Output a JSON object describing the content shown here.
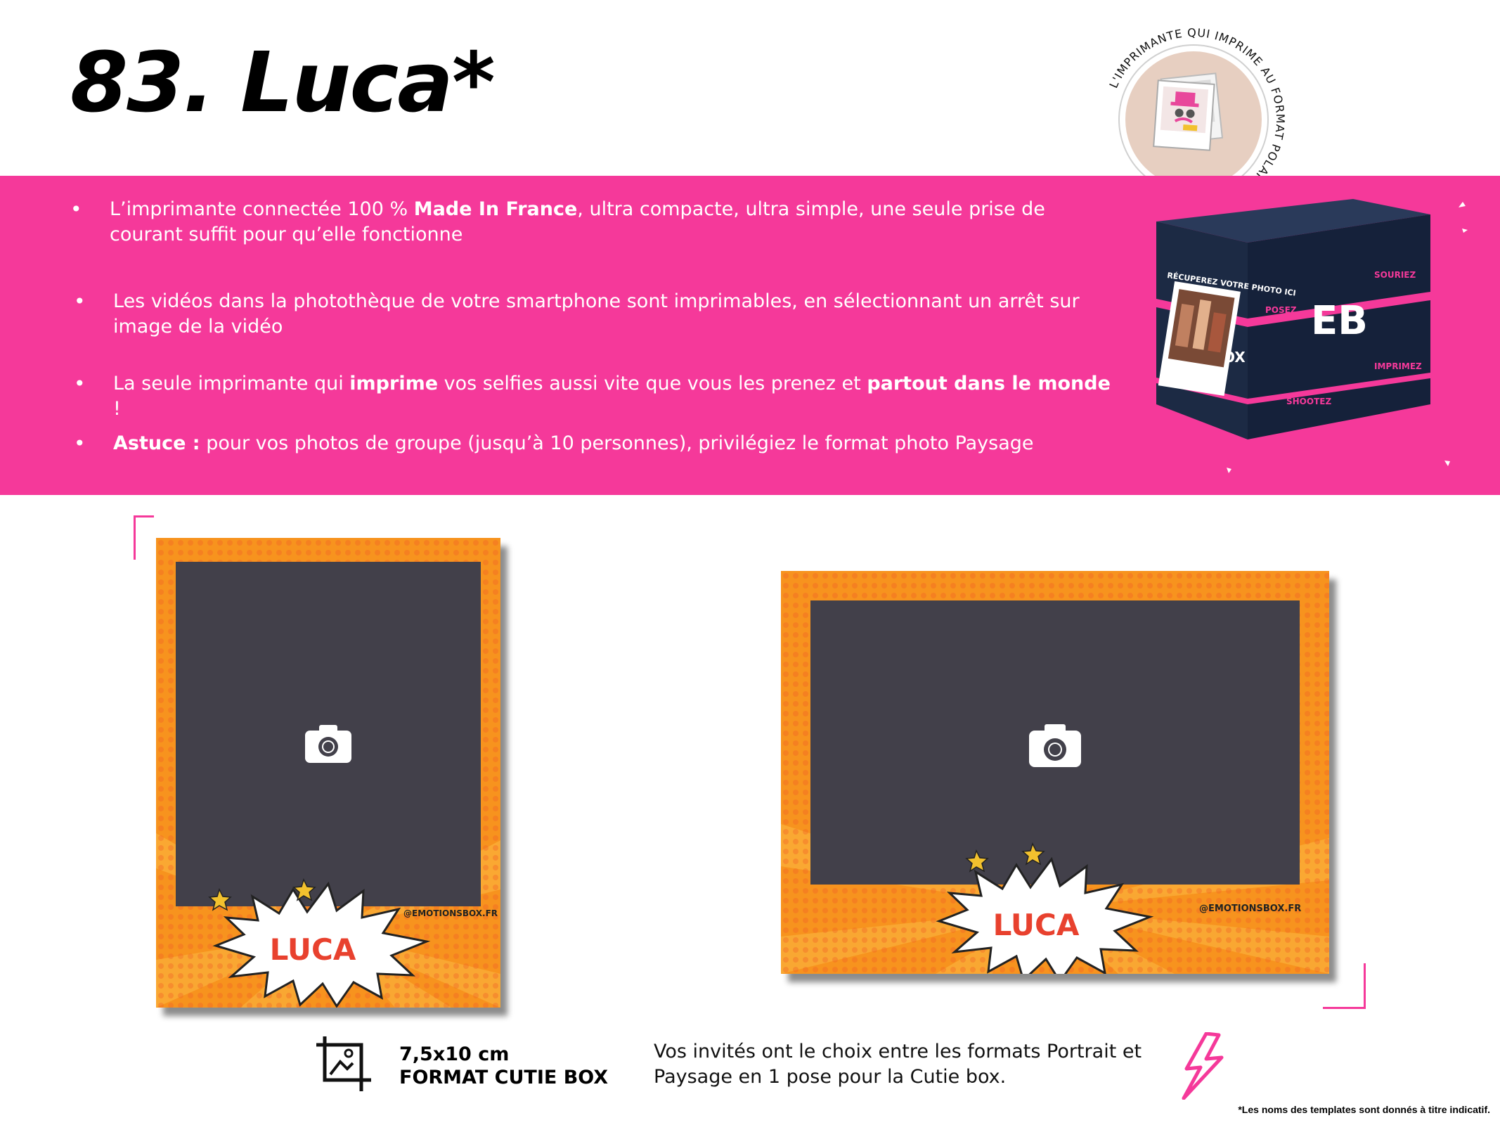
{
  "page": {
    "title": "83. Luca*"
  },
  "badge": {
    "ring_text": "L'IMPRIMANTE QUI IMPRIME AU FORMAT POLAROÏD"
  },
  "bullets": [
    {
      "parts": [
        {
          "text": "L’imprimante connectée 100 % ",
          "bold": false
        },
        {
          "text": "Made In France",
          "bold": true
        },
        {
          "text": ", ultra compacte, ultra simple, une seule prise de courant suffit pour qu’elle fonctionne",
          "bold": false
        }
      ]
    },
    {
      "parts": [
        {
          "text": "Les vidéos dans la photothèque de votre smartphone sont imprimables, en sélectionnant un arrêt sur image de la vidéo",
          "bold": false
        }
      ]
    },
    {
      "parts": [
        {
          "text": "La seule imprimante qui ",
          "bold": false
        },
        {
          "text": "imprime",
          "bold": true
        },
        {
          "text": " vos selfies aussi vite que vous les prenez et ",
          "bold": false
        },
        {
          "text": "partout dans le monde",
          "bold": true
        },
        {
          "text": " !",
          "bold": false
        }
      ]
    },
    {
      "parts": [
        {
          "text": "Astuce :",
          "bold": true
        },
        {
          "text": " pour vos photos de groupe (jusqu’à 10 personnes), privilégiez le format photo Paysage",
          "bold": false
        }
      ]
    }
  ],
  "printer": {
    "slot_label": "RÉCUPEREZ VOTRE PHOTO ICI",
    "logo": "EB",
    "side_words": [
      "POSEZ",
      "SOURIEZ",
      "IMPRIMEZ",
      "SHOOTEZ"
    ],
    "front_word": "OX"
  },
  "templates": {
    "name": "LUCA",
    "credit": "@EMOTIONSBOX.FR",
    "camera_icon": "camera-icon",
    "colors": {
      "orange": "#f7931e",
      "orange_light": "#fbb03b",
      "orange_dark": "#f15a24",
      "photo_area": "#42404a",
      "name_red": "#e8412e"
    }
  },
  "format": {
    "size": "7,5x10 cm",
    "label": "FORMAT CUTIE BOX",
    "description": "Vos invités ont le choix entre les formats Portrait et Paysage en 1 pose pour la Cutie box."
  },
  "footnote": "*Les noms des templates sont donnés à titre indicatif.",
  "colors": {
    "accent_pink": "#f5399a",
    "printer_navy": "#1c2a44"
  }
}
